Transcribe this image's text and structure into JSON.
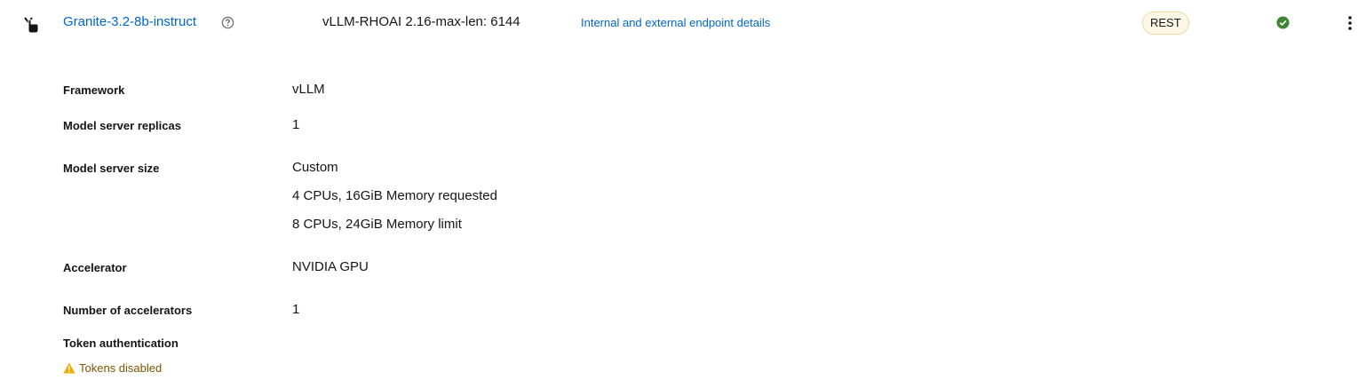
{
  "row": {
    "model_name": "Granite-3.2-8b-instruct",
    "serving_runtime": "vLLM-RHOAI 2.16-max-len: 6144",
    "endpoint_link": "Internal and external endpoint details",
    "api_protocol": "REST",
    "status": "success",
    "status_color": "#3e8635",
    "link_color": "#0066cc"
  },
  "icons": {
    "toggle": "chevron-down-icon",
    "help": "help-circle-icon",
    "status": "check-circle-icon",
    "actions": "kebab-icon",
    "warning": "warning-triangle-icon"
  },
  "details": {
    "framework": {
      "label": "Framework",
      "value": "vLLM"
    },
    "replicas": {
      "label": "Model server replicas",
      "value": "1"
    },
    "size": {
      "label": "Model server size",
      "lines": [
        "Custom",
        "4 CPUs, 16GiB Memory requested",
        "8 CPUs, 24GiB Memory limit"
      ]
    },
    "accelerator": {
      "label": "Accelerator",
      "value": "NVIDIA GPU"
    },
    "num_accelerators": {
      "label": "Number of accelerators",
      "value": "1"
    },
    "token_auth": {
      "label": "Token authentication",
      "value": "Tokens disabled",
      "warning_color": "#f0ab00"
    }
  }
}
